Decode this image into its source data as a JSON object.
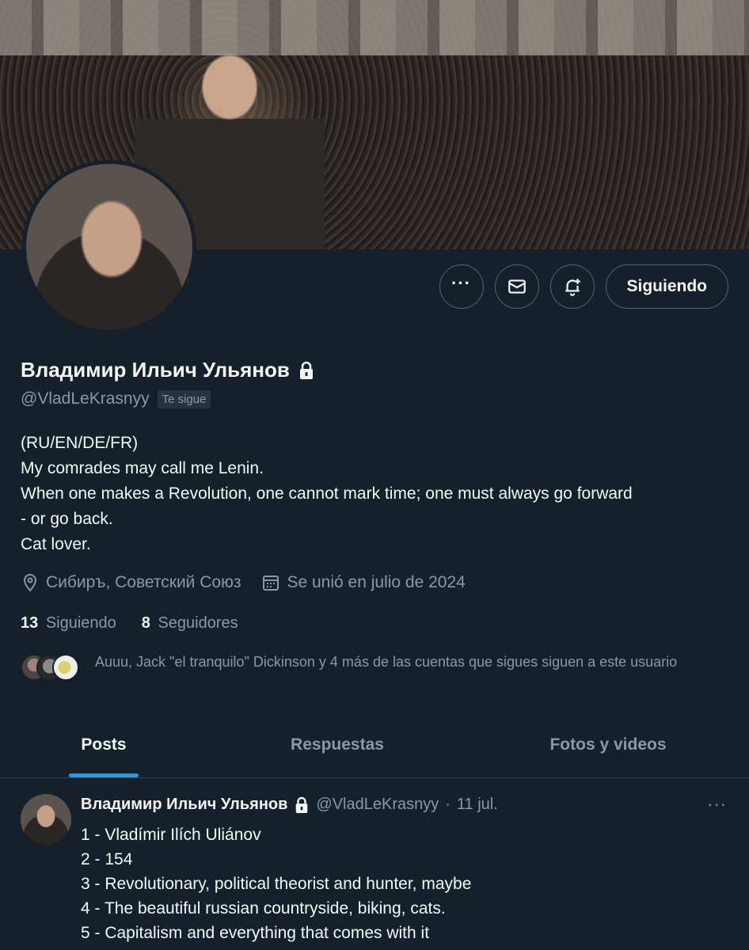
{
  "profile": {
    "name": "Владимир Ильич Ульянов",
    "handle": "@VladLeKrasnyy",
    "follows_you_badge": "Te sigue",
    "follow_button": "Siguiendo",
    "bio": [
      "(RU/EN/DE/FR)",
      "My comrades may call me Lenin.",
      "When one makes a Revolution, one cannot mark time; one must always go forward",
      "- or go back.",
      "Cat lover."
    ],
    "location": "Сибиръ, Советский Союз",
    "joined": "Se unió en julio de 2024",
    "following_count": "13",
    "following_label": "Siguiendo",
    "followers_count": "8",
    "followers_label": "Seguidores",
    "followed_by_text": "Auuu, Jack \"el tranquilo\" Dickinson y 4 más de las cuentas que sigues siguen a este usuario"
  },
  "tabs": [
    {
      "label": "Posts",
      "active": true
    },
    {
      "label": "Respuestas",
      "active": false
    },
    {
      "label": "Fotos y videos",
      "active": false
    }
  ],
  "post": {
    "name": "Владимир Ильич Ульянов",
    "handle": "@VladLeKrasnyy",
    "separator": "·",
    "date": "11 jul.",
    "more": "···",
    "lines": [
      "1 - Vladímir Ilích Uliánov",
      "2 - 154",
      "3 - Revolutionary, political theorist and hunter, maybe",
      "4 - The beautiful russian countryside, biking, cats.",
      "5 - Capitalism and everything that comes with it"
    ]
  },
  "icons": {
    "more": "more-icon",
    "message": "envelope-icon",
    "notify": "bell-plus-icon",
    "lock": "lock-icon",
    "location": "location-pin-icon",
    "calendar": "calendar-icon"
  },
  "colors": {
    "background": "#15202b",
    "text": "#f7f9f9",
    "secondary_text": "#8b98a5",
    "accent": "#1d9bf0",
    "border": "#536471"
  }
}
